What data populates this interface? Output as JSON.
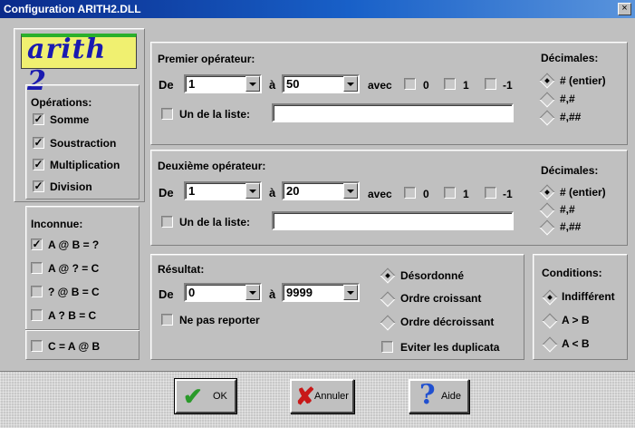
{
  "window": {
    "title": "Configuration ARITH2.DLL",
    "close_glyph": "×"
  },
  "logo": {
    "text": "arith 2"
  },
  "operations": {
    "title": "Opérations:",
    "items": [
      {
        "label": "Somme",
        "checked": true
      },
      {
        "label": "Soustraction",
        "checked": true
      },
      {
        "label": "Multiplication",
        "checked": true
      },
      {
        "label": "Division",
        "checked": true
      }
    ]
  },
  "inconnue": {
    "title": "Inconnue:",
    "items": [
      {
        "label": "A @ B = ?",
        "checked": true
      },
      {
        "label": "A @ ? = C",
        "checked": false
      },
      {
        "label": "? @ B = C",
        "checked": false
      },
      {
        "label": "A ? B = C",
        "checked": false
      }
    ],
    "extra": {
      "label": "C = A @ B",
      "checked": false
    }
  },
  "premier": {
    "title": "Premier opérateur:",
    "de_label": "De",
    "de_value": "1",
    "a_label": "à",
    "a_value": "50",
    "avec_label": "avec",
    "avec_options": [
      "0",
      "1",
      "-1"
    ],
    "liste_label": "Un de la liste:",
    "liste_value": "",
    "decimales_title": "Décimales:",
    "decimales": [
      "# (entier)",
      "#,#",
      "#,##"
    ],
    "decimales_selected": 0
  },
  "deuxieme": {
    "title": "Deuxième opérateur:",
    "de_label": "De",
    "de_value": "1",
    "a_label": "à",
    "a_value": "20",
    "avec_label": "avec",
    "avec_options": [
      "0",
      "1",
      "-1"
    ],
    "liste_label": "Un de la liste:",
    "liste_value": "",
    "decimales_title": "Décimales:",
    "decimales": [
      "# (entier)",
      "#,#",
      "#,##"
    ],
    "decimales_selected": 0
  },
  "resultat": {
    "title": "Résultat:",
    "de_label": "De",
    "de_value": "0",
    "a_label": "à",
    "a_value": "9999",
    "reporter_label": "Ne pas reporter",
    "ordre": [
      "Désordonné",
      "Ordre croissant",
      "Ordre décroissant"
    ],
    "ordre_selected": 0,
    "duplicata_label": "Eviter les duplicata"
  },
  "conditions": {
    "title": "Conditions:",
    "options": [
      "Indifférent",
      "A > B",
      "A < B"
    ],
    "selected": 0
  },
  "buttons": {
    "ok": "OK",
    "annuler": "Annuler",
    "aide": "Aide"
  },
  "colors": {
    "title_start": "#0a2a8a",
    "title_end": "#5a94dc",
    "logo_bg": "#f0f070",
    "logo_text": "#1a1ab0",
    "checkmark_green": "#2a9a2a",
    "cancel_red": "#c81818",
    "help_blue": "#2050d0"
  }
}
